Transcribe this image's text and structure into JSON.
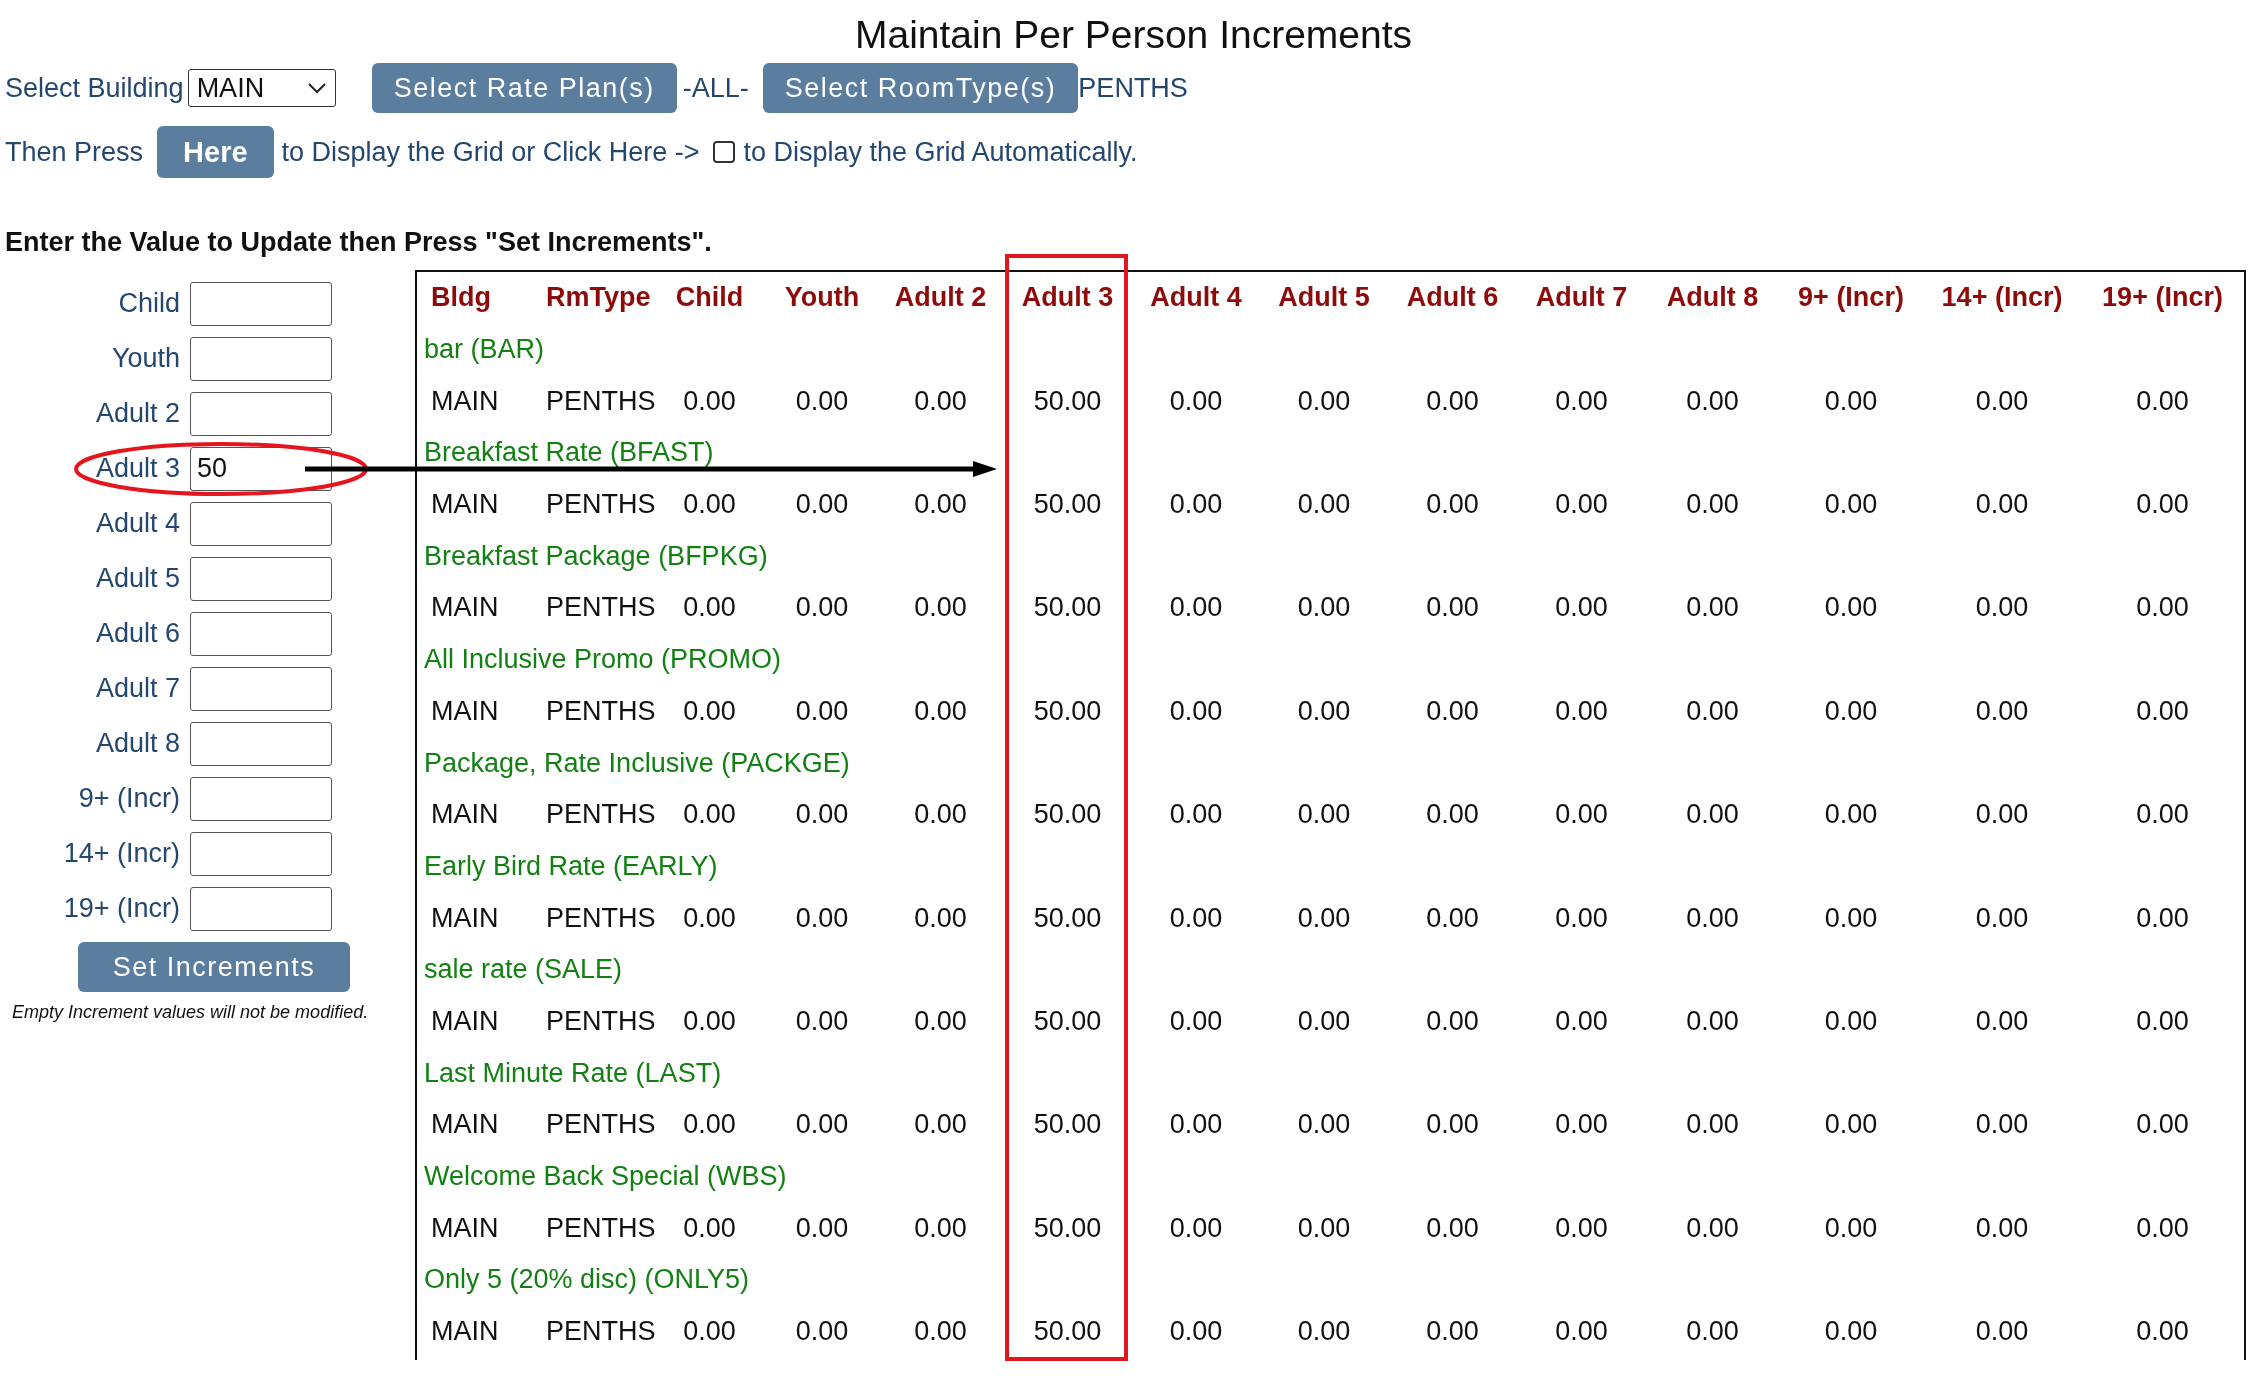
{
  "title": "Maintain Per Person Increments",
  "toolbar": {
    "building_label": "Select Building",
    "building": {
      "value": "MAIN"
    },
    "rate_plan_button": "Select Rate Plan(s)",
    "rate_plan_value": "-ALL-",
    "room_type_button": "Select RoomType(s)",
    "room_type_value": "PENTHS"
  },
  "display_row": {
    "lead": "Then Press",
    "button": "Here",
    "middle": "to Display the Grid or Click Here ->",
    "auto_checkbox": {
      "checked": false
    },
    "tail": "to Display the Grid Automatically."
  },
  "instruction": "Enter the Value to Update then Press \"Set Increments\".",
  "increment_form": {
    "fields": [
      {
        "label": "Child",
        "highlighted": false
      },
      {
        "label": "Youth",
        "highlighted": false
      },
      {
        "label": "Adult 2",
        "highlighted": false
      },
      {
        "label": "Adult 3",
        "value": "50",
        "highlighted": true
      },
      {
        "label": "Adult 4",
        "highlighted": false
      },
      {
        "label": "Adult 5",
        "highlighted": false
      },
      {
        "label": "Adult 6",
        "highlighted": false
      },
      {
        "label": "Adult 7",
        "highlighted": false
      },
      {
        "label": "Adult 8",
        "highlighted": false
      },
      {
        "label": "9+ (Incr)",
        "highlighted": false
      },
      {
        "label": "14+ (Incr)",
        "highlighted": false
      },
      {
        "label": "19+ (Incr)",
        "highlighted": false
      }
    ],
    "submit_button": "Set Increments",
    "note": "Empty Increment values will not be modified."
  },
  "table": {
    "columns": [
      {
        "label": "Bldg",
        "highlighted": false
      },
      {
        "label": "RmType",
        "highlighted": false
      },
      {
        "label": "Child",
        "highlighted": false
      },
      {
        "label": "Youth",
        "highlighted": false
      },
      {
        "label": "Adult 2",
        "highlighted": false
      },
      {
        "label": "Adult 3",
        "highlighted": true
      },
      {
        "label": "Adult 4",
        "highlighted": false
      },
      {
        "label": "Adult 5",
        "highlighted": false
      },
      {
        "label": "Adult 6",
        "highlighted": false
      },
      {
        "label": "Adult 7",
        "highlighted": false
      },
      {
        "label": "Adult 8",
        "highlighted": false
      },
      {
        "label": "9+ (Incr)",
        "highlighted": false
      },
      {
        "label": "14+ (Incr)",
        "highlighted": false
      },
      {
        "label": "19+ (Incr)",
        "highlighted": false
      }
    ],
    "groups": [
      {
        "rate_plan": "bar (BAR)",
        "rows": [
          [
            "MAIN",
            "PENTHS",
            "0.00",
            "0.00",
            "0.00",
            "50.00",
            "0.00",
            "0.00",
            "0.00",
            "0.00",
            "0.00",
            "0.00",
            "0.00",
            "0.00"
          ]
        ]
      },
      {
        "rate_plan": "Breakfast Rate (BFAST)",
        "rows": [
          [
            "MAIN",
            "PENTHS",
            "0.00",
            "0.00",
            "0.00",
            "50.00",
            "0.00",
            "0.00",
            "0.00",
            "0.00",
            "0.00",
            "0.00",
            "0.00",
            "0.00"
          ]
        ]
      },
      {
        "rate_plan": "Breakfast Package (BFPKG)",
        "rows": [
          [
            "MAIN",
            "PENTHS",
            "0.00",
            "0.00",
            "0.00",
            "50.00",
            "0.00",
            "0.00",
            "0.00",
            "0.00",
            "0.00",
            "0.00",
            "0.00",
            "0.00"
          ]
        ]
      },
      {
        "rate_plan": "All Inclusive Promo (PROMO)",
        "rows": [
          [
            "MAIN",
            "PENTHS",
            "0.00",
            "0.00",
            "0.00",
            "50.00",
            "0.00",
            "0.00",
            "0.00",
            "0.00",
            "0.00",
            "0.00",
            "0.00",
            "0.00"
          ]
        ]
      },
      {
        "rate_plan": "Package, Rate Inclusive (PACKGE)",
        "rows": [
          [
            "MAIN",
            "PENTHS",
            "0.00",
            "0.00",
            "0.00",
            "50.00",
            "0.00",
            "0.00",
            "0.00",
            "0.00",
            "0.00",
            "0.00",
            "0.00",
            "0.00"
          ]
        ]
      },
      {
        "rate_plan": "Early Bird Rate (EARLY)",
        "rows": [
          [
            "MAIN",
            "PENTHS",
            "0.00",
            "0.00",
            "0.00",
            "50.00",
            "0.00",
            "0.00",
            "0.00",
            "0.00",
            "0.00",
            "0.00",
            "0.00",
            "0.00"
          ]
        ]
      },
      {
        "rate_plan": "sale rate (SALE)",
        "rows": [
          [
            "MAIN",
            "PENTHS",
            "0.00",
            "0.00",
            "0.00",
            "50.00",
            "0.00",
            "0.00",
            "0.00",
            "0.00",
            "0.00",
            "0.00",
            "0.00",
            "0.00"
          ]
        ]
      },
      {
        "rate_plan": "Last Minute Rate (LAST)",
        "rows": [
          [
            "MAIN",
            "PENTHS",
            "0.00",
            "0.00",
            "0.00",
            "50.00",
            "0.00",
            "0.00",
            "0.00",
            "0.00",
            "0.00",
            "0.00",
            "0.00",
            "0.00"
          ]
        ]
      },
      {
        "rate_plan": "Welcome Back Special (WBS)",
        "rows": [
          [
            "MAIN",
            "PENTHS",
            "0.00",
            "0.00",
            "0.00",
            "50.00",
            "0.00",
            "0.00",
            "0.00",
            "0.00",
            "0.00",
            "0.00",
            "0.00",
            "0.00"
          ]
        ]
      },
      {
        "rate_plan": "Only 5 (20% disc) (ONLY5)",
        "rows": [
          [
            "MAIN",
            "PENTHS",
            "0.00",
            "0.00",
            "0.00",
            "50.00",
            "0.00",
            "0.00",
            "0.00",
            "0.00",
            "0.00",
            "0.00",
            "0.00",
            "0.00"
          ]
        ]
      }
    ]
  }
}
